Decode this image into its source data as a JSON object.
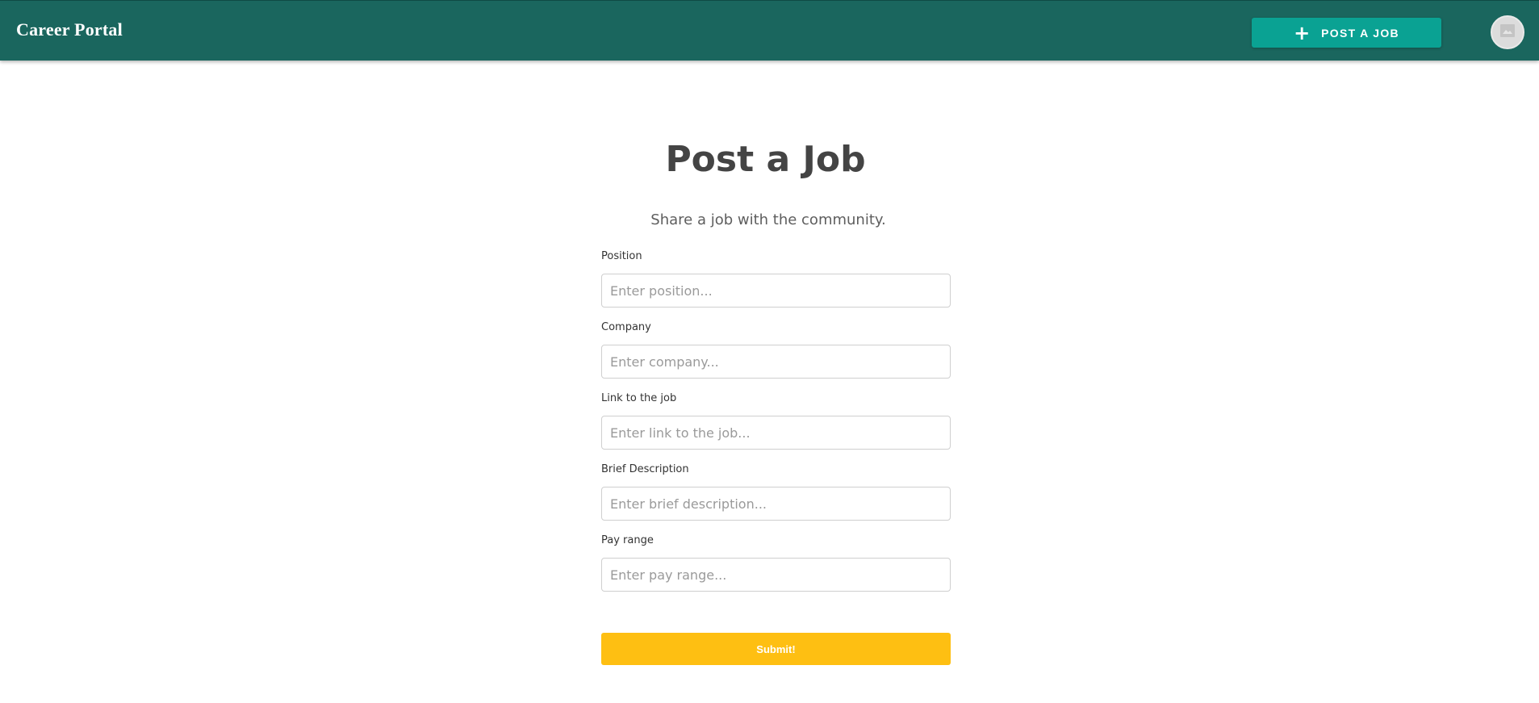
{
  "header": {
    "brand": "Career Portal",
    "post_button": {
      "icon": "plus-icon",
      "label": "POST A JOB"
    },
    "avatar_icon": "image-placeholder-icon"
  },
  "main": {
    "title": "Post a Job",
    "subtitle": "Share a job with the community.",
    "fields": [
      {
        "label": "Position",
        "placeholder": "Enter position...",
        "value": ""
      },
      {
        "label": "Company",
        "placeholder": "Enter company...",
        "value": ""
      },
      {
        "label": "Link to the job",
        "placeholder": "Enter link to the job...",
        "value": ""
      },
      {
        "label": "Brief Description",
        "placeholder": "Enter brief description...",
        "value": ""
      },
      {
        "label": "Pay range",
        "placeholder": "Enter pay range...",
        "value": ""
      }
    ],
    "submit_label": "Submit!"
  },
  "colors": {
    "header_bg": "#1a665e",
    "post_button_bg": "#0aa293",
    "submit_bg": "#febf12",
    "title_text": "#444444"
  }
}
